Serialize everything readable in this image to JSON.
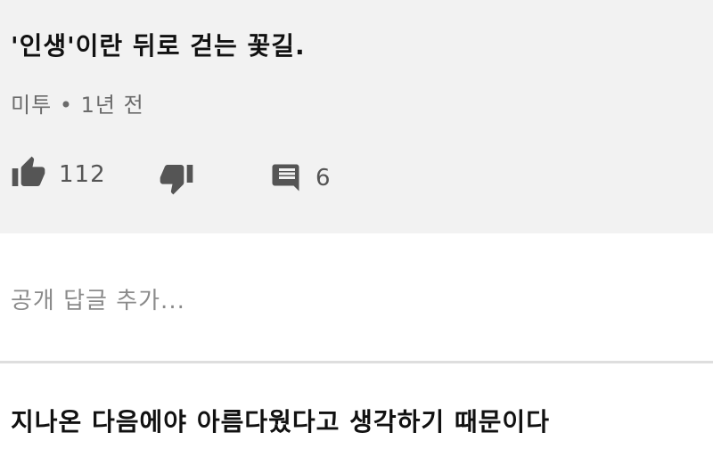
{
  "comment": {
    "text": "'인생'이란 뒤로 걷는 꽃길.",
    "author": "미투",
    "separator": "•",
    "time": "1년 전",
    "like_count": "112",
    "reply_count": "6"
  },
  "reply_box": {
    "placeholder": "공개 답글 추가..."
  },
  "next_comment": {
    "text": "지나온 다음에야 아름다웠다고 생각하기 때문이다"
  },
  "icons": {
    "like": "thumbs-up-icon",
    "dislike": "thumbs-down-icon",
    "reply": "comment-icon"
  },
  "colors": {
    "card_background": "#f2f2f2",
    "meta_text": "#6b6b6b",
    "icon": "#555555"
  }
}
